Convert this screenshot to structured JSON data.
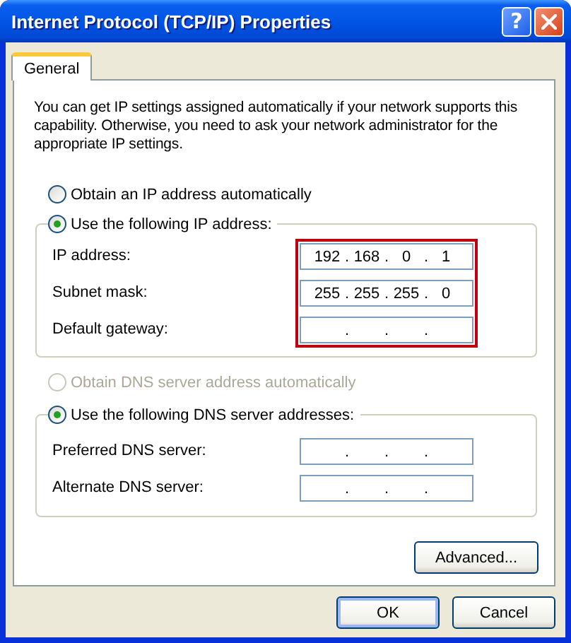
{
  "window": {
    "title": "Internet Protocol (TCP/IP) Properties",
    "help_button": "?"
  },
  "tabs": [
    {
      "label": "General",
      "selected": true
    }
  ],
  "intro": "You can get IP settings assigned automatically if your network supports this capability. Otherwise, you need to ask your network administrator for the appropriate IP settings.",
  "ip_options": [
    {
      "label": "Obtain an IP address automatically",
      "selected": false,
      "disabled": false
    },
    {
      "label": "Use the following IP address:",
      "selected": true,
      "disabled": false
    }
  ],
  "ip_group": {
    "highlighted": true,
    "fields": [
      {
        "label": "IP address:",
        "octets": [
          "192",
          "168",
          "0",
          "1"
        ],
        "separator": "."
      },
      {
        "label": "Subnet mask:",
        "octets": [
          "255",
          "255",
          "255",
          "0"
        ],
        "separator": "."
      },
      {
        "label": "Default gateway:",
        "separator": "."
      }
    ]
  },
  "dns_options": [
    {
      "label": "Obtain DNS server address automatically",
      "selected": false,
      "disabled": true
    },
    {
      "label": "Use the following DNS server addresses:",
      "selected": true,
      "disabled": false
    }
  ],
  "dns_group": {
    "fields": [
      {
        "label": "Preferred DNS server:",
        "separator": "."
      },
      {
        "label": "Alternate DNS server:",
        "separator": "."
      }
    ]
  },
  "advanced_button": "Advanced...",
  "buttons": [
    {
      "label": "OK",
      "default": true
    },
    {
      "label": "Cancel",
      "default": false
    }
  ]
}
